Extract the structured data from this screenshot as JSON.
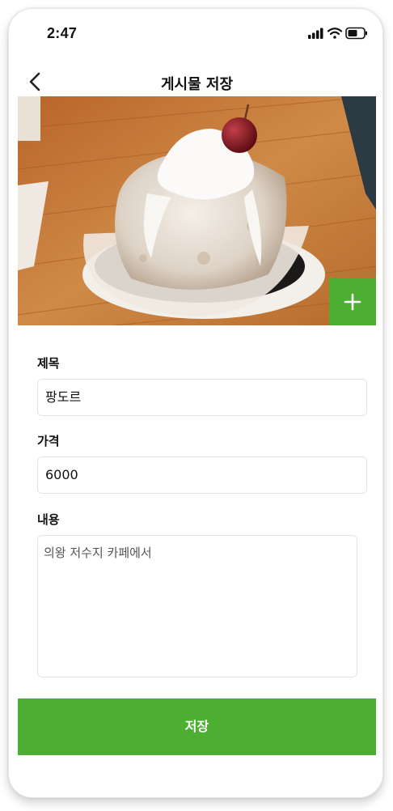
{
  "status_bar": {
    "time": "2:47",
    "icons": [
      "cellular-signal-icon",
      "wifi-icon",
      "battery-icon"
    ]
  },
  "header": {
    "back_icon": "chevron-left-icon",
    "title": "게시물 저장"
  },
  "photo": {
    "description_icon": "dessert-photo",
    "add_icon": "plus-icon"
  },
  "form": {
    "title_label": "제목",
    "title_value": "팡도르",
    "price_label": "가격",
    "price_value": "6000",
    "content_label": "내용",
    "content_value": "의왕 저수지 카페에서"
  },
  "actions": {
    "save_label": "저장"
  },
  "colors": {
    "accent": "#4caf32",
    "input_border": "#e4e4e4"
  }
}
